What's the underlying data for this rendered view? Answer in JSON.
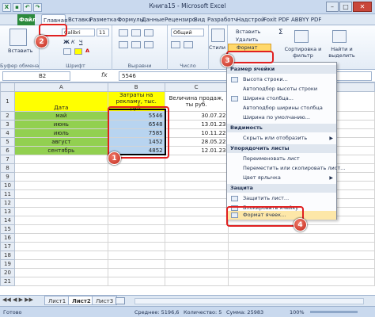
{
  "window": {
    "title": "Книга15 - Microsoft Excel",
    "qat_icons": [
      "excel-icon",
      "save-icon",
      "undo-icon",
      "redo-icon"
    ]
  },
  "tabs": [
    "Файл",
    "Главная",
    "Вставка",
    "Разметка с",
    "Формулы",
    "Данные",
    "Рецензиро",
    "Вид",
    "Разработч",
    "Надстрой",
    "Foxit PDF",
    "ABBYY PDF"
  ],
  "ribbon": {
    "paste": "Вставить",
    "font_name": "Calibri",
    "font_size": "11",
    "number_format": "Общий",
    "styles": "Стили",
    "insert": "Вставить",
    "delete": "Удалить",
    "format": "Формат",
    "sort": "Сортировка и фильтр",
    "find": "Найти и выделить",
    "groups": {
      "clipboard": "Буфер обмена",
      "font": "Шрифт",
      "alignment": "Выравни",
      "number": "Число"
    }
  },
  "formula_bar": {
    "name_box": "B2",
    "fx": "fx",
    "value": "5546"
  },
  "sheet": {
    "col_headers": [
      "A",
      "B",
      "C"
    ],
    "header_row": {
      "a": "Дата",
      "b": "Затраты на рекламу, тыс. руб.",
      "c": "Величина продаж, ты руб."
    },
    "rows": [
      {
        "n": "1"
      },
      {
        "n": "2",
        "a": "май",
        "b": "5546",
        "c": "30.07.22"
      },
      {
        "n": "3",
        "a": "июнь",
        "b": "6548",
        "c": "13.01.23"
      },
      {
        "n": "4",
        "a": "июль",
        "b": "7585",
        "c": "10.11.22"
      },
      {
        "n": "5",
        "a": "август",
        "b": "1452",
        "c": "28.05.22"
      },
      {
        "n": "6",
        "a": "сентябрь",
        "b": "4852",
        "c": "12.01.23"
      },
      {
        "n": "7"
      },
      {
        "n": "8"
      },
      {
        "n": "9"
      },
      {
        "n": "10"
      },
      {
        "n": "11"
      },
      {
        "n": "12"
      },
      {
        "n": "13"
      },
      {
        "n": "14"
      },
      {
        "n": "15"
      },
      {
        "n": "16"
      },
      {
        "n": "17"
      },
      {
        "n": "18"
      },
      {
        "n": "19"
      },
      {
        "n": "20"
      },
      {
        "n": "21"
      }
    ]
  },
  "menu": {
    "section_size": "Размер ячейки",
    "row_height": "Высота строки...",
    "autofit_row": "Автоподбор высоты строки",
    "col_width": "Ширина столбца...",
    "autofit_col": "Автоподбор ширины столбца",
    "default_width": "Ширина по умолчанию...",
    "section_visibility": "Видимость",
    "hide_show": "Скрыть или отобразить",
    "section_order": "Упорядочить листы",
    "rename": "Переименовать лист",
    "move_copy": "Переместить или скопировать лист...",
    "tab_color": "Цвет ярлычка",
    "section_protect": "Защита",
    "protect_sheet": "Защитить лист...",
    "lock_cell": "Блокировать ячейку",
    "format_cells": "Формат ячеек..."
  },
  "badges": [
    "1",
    "2",
    "3",
    "4"
  ],
  "sheet_tabs": [
    "Лист1",
    "Лист2",
    "Лист3"
  ],
  "status": {
    "ready": "Готово",
    "average": "Среднее: 5196,6",
    "count": "Количество: 5",
    "sum": "Сумма: 25983",
    "zoom": "100%"
  },
  "colors": {
    "file_tab": "#2c8a3d",
    "highlight": "#e02020",
    "yellow": "#ffff00",
    "green": "#92d050",
    "blue": "#b8d4f0"
  }
}
